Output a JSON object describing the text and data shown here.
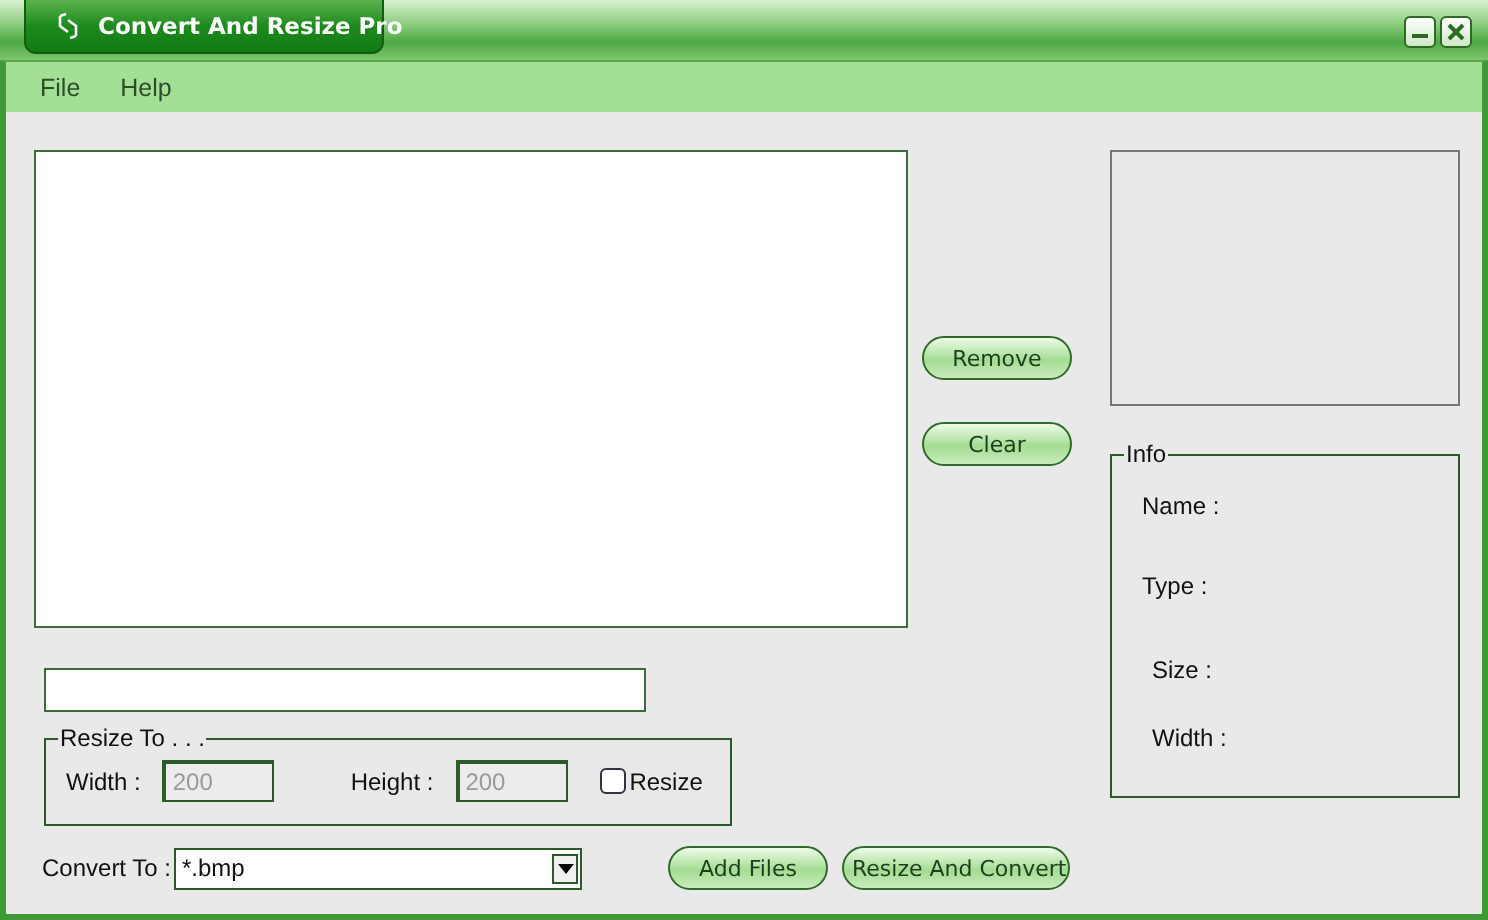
{
  "window": {
    "title": "Convert And Resize Pro"
  },
  "menu": [
    {
      "label": "File"
    },
    {
      "label": "Help"
    }
  ],
  "side_buttons": [
    {
      "label": "Remove"
    },
    {
      "label": "Clear"
    }
  ],
  "resize_group": {
    "title": "Resize To . . .",
    "width_label": "Width :",
    "width_value": "200",
    "height_label": "Height :",
    "height_value": "200",
    "disabled": true,
    "checkbox": {
      "label": "Resize",
      "checked": false
    }
  },
  "convert": {
    "label": "Convert To :",
    "value": "*.bmp"
  },
  "bottom_buttons": [
    {
      "label": "Add Files"
    },
    {
      "label": "Resize And Convert"
    }
  ],
  "info": {
    "title": "Info",
    "fields": [
      {
        "label": "Name :"
      },
      {
        "label": "Type :"
      },
      {
        "label": "Size :"
      },
      {
        "label": "Width :"
      }
    ]
  }
}
